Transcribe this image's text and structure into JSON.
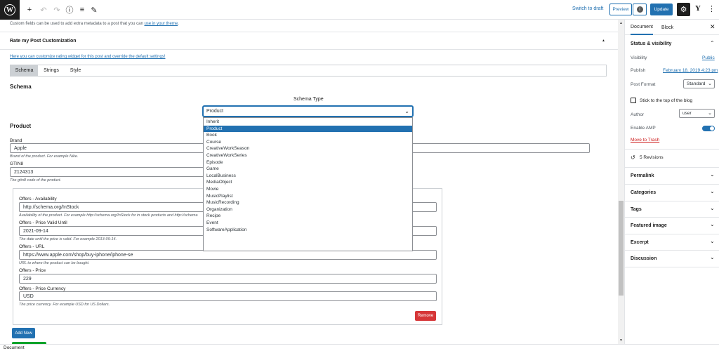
{
  "toolbar": {
    "logo_letter": "W",
    "add_icon": "+",
    "undo_icon": "↶",
    "redo_icon": "↷",
    "info_icon": "ⓘ",
    "list_icon": "≡",
    "edit_icon": "✎",
    "switch_to_draft": "Switch to draft",
    "preview": "Preview",
    "update": "Update",
    "settings_icon": "⚙",
    "yoast_icon": "Y",
    "more_icon": "⋮"
  },
  "main": {
    "custom_fields_text": "Custom fields can be used to add extra metadata to a post that you can",
    "custom_fields_link": "use in your theme",
    "custom_fields_end": ".",
    "panel_title": "Rate my Post Customization",
    "panel_collapse_icon": "▲",
    "customize_link": "Here you can customize rating widget for this post and override the default settings!",
    "tabs": [
      {
        "label": "Schema"
      },
      {
        "label": "Strings"
      },
      {
        "label": "Style"
      }
    ],
    "schema_heading": "Schema",
    "schema_type_label": "Schema Type",
    "schema_type_value": "Product",
    "schema_options": [
      "Inherit",
      "Product",
      "Book",
      "Course",
      "CreativeWorkSeason",
      "CreativeWorkSeries",
      "Episode",
      "Game",
      "LocalBusiness",
      "MediaObject",
      "Movie",
      "MusicPlaylist",
      "MusicRecording",
      "Organization",
      "Recipe",
      "Event",
      "SoftwareApplication"
    ],
    "product_heading": "Product",
    "brand": {
      "label": "Brand",
      "value": "Apple",
      "hint": "Brand of the product. For example Nike."
    },
    "gtin8": {
      "label": "GTIN8",
      "value": "2124313",
      "hint": "The gtin8 code of the product."
    },
    "offers": {
      "availability": {
        "label": "Offers - Availability",
        "value": "http://schema.org/InStock",
        "hint": "Availability of the product. For example http://schema.org/InStock for in stock products and http://schema"
      },
      "valid_until": {
        "label": "Offers - Price Valid Until",
        "value": "2021-09-14",
        "hint": "The date until the price is valid. For example 2013-09-14."
      },
      "url": {
        "label": "Offers - URL",
        "value": "https://www.apple.com/shop/buy-iphone/iphone-se",
        "hint": "URL to where the product can be bought."
      },
      "price": {
        "label": "Offers - Price",
        "value": "229"
      },
      "currency": {
        "label": "Offers - Price Currency",
        "value": "USD",
        "hint": "The price currency. For example USD for US Dollars."
      },
      "remove": "Remove"
    },
    "add_new": "Add New"
  },
  "sidebar": {
    "tabs": [
      {
        "label": "Document"
      },
      {
        "label": "Block"
      }
    ],
    "close_icon": "✕",
    "status_title": "Status & visibility",
    "visibility_label": "Visibility",
    "visibility_value": "Public",
    "publish_label": "Publish",
    "publish_value": "February 18, 2019 4:23 pm",
    "post_format_label": "Post Format",
    "post_format_value": "Standard",
    "sticky_label": "Stick to the top of the blog",
    "author_label": "Author",
    "author_value": "user",
    "amp_label": "Enable AMP",
    "trash": "Move to Trash",
    "revisions_icon": "↺",
    "revisions": "5 Revisions",
    "sections": [
      {
        "label": "Permalink"
      },
      {
        "label": "Categories"
      },
      {
        "label": "Tags"
      },
      {
        "label": "Featured image"
      },
      {
        "label": "Excerpt"
      },
      {
        "label": "Discussion"
      }
    ],
    "chevron_down": "⌄",
    "chevron_up": "⌃"
  },
  "footer": {
    "breadcrumb": "Document"
  }
}
